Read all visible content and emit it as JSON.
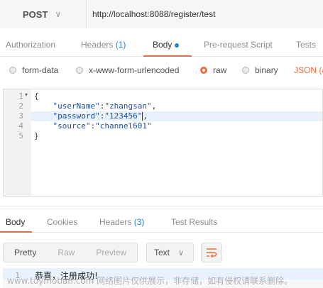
{
  "request": {
    "method": "POST",
    "url": "http://localhost:8088/register/test"
  },
  "request_tabs": [
    {
      "label": "Authorization"
    },
    {
      "label": "Headers",
      "count": "(1)"
    },
    {
      "label": "Body"
    },
    {
      "label": "Pre-request Script"
    },
    {
      "label": "Tests"
    }
  ],
  "body_types": {
    "form_data": "form-data",
    "urlencoded": "x-www-form-urlencoded",
    "raw": "raw",
    "binary": "binary",
    "content_type": "JSON (a"
  },
  "editor": {
    "line_numbers": [
      "1",
      "2",
      "3",
      "4",
      "5"
    ],
    "lines": {
      "l1": "{",
      "l2_key": "\"userName\"",
      "l2_val": "\"zhangsan\"",
      "l3_key": "\"password\"",
      "l3_val": "\"123456\"",
      "l4_key": "\"source\"",
      "l4_val": "\"channel601\"",
      "l5": "}"
    }
  },
  "response_tabs": [
    {
      "label": "Body"
    },
    {
      "label": "Cookies"
    },
    {
      "label": "Headers",
      "count": "(3)"
    },
    {
      "label": "Test Results"
    }
  ],
  "response_toolbar": {
    "pretty": "Pretty",
    "raw": "Raw",
    "preview": "Preview",
    "format": "Text"
  },
  "response_body": {
    "line_number": "1",
    "text": "恭喜，注册成功!"
  },
  "watermark": "www.toymoban.com 网络图片仅供展示，非存储，如有侵权请联系删除。",
  "colors": {
    "accent": "#f26b3a",
    "count_blue": "#2a7fd4",
    "string": "#1f4ea8"
  }
}
